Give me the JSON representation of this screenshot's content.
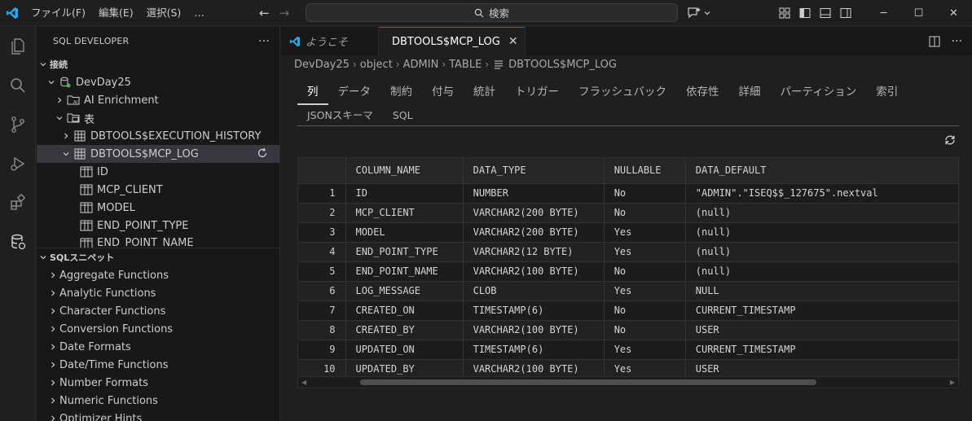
{
  "titlebar": {
    "menu": [
      "ファイル(F)",
      "編集(E)",
      "選択(S)",
      "…"
    ],
    "search_placeholder": "検索"
  },
  "sidebar": {
    "title": "SQL DEVELOPER",
    "connections_header": "接続",
    "connection_name": "DevDay25",
    "ai_enrichment": "AI Enrichment",
    "tables_label": "表",
    "tables": [
      "DBTOOLS$EXECUTION_HISTORY",
      "DBTOOLS$MCP_LOG"
    ],
    "columns": [
      "ID",
      "MCP_CLIENT",
      "MODEL",
      "END_POINT_TYPE",
      "END_POINT_NAME"
    ],
    "snippets_header": "SQLスニペット",
    "snippets": [
      "Aggregate Functions",
      "Analytic Functions",
      "Character Functions",
      "Conversion Functions",
      "Date Formats",
      "Date/Time Functions",
      "Number Formats",
      "Numeric Functions",
      "Optimizer Hints"
    ]
  },
  "editor": {
    "tabs": [
      {
        "label": "ようこそ"
      },
      {
        "label": "DBTOOLS$MCP_LOG"
      }
    ],
    "breadcrumb": [
      "DevDay25",
      "object",
      "ADMIN",
      "TABLE",
      "DBTOOLS$MCP_LOG"
    ],
    "subtabs_row1": [
      "列",
      "データ",
      "制約",
      "付与",
      "統計",
      "トリガー",
      "フラッシュバック",
      "依存性",
      "詳細",
      "パーティション",
      "索引"
    ],
    "subtabs_row2": [
      "JSONスキーマ",
      "SQL"
    ],
    "active_subtab": "列"
  },
  "grid": {
    "columns": [
      "COLUMN_NAME",
      "DATA_TYPE",
      "NULLABLE",
      "DATA_DEFAULT"
    ],
    "rows": [
      [
        "1",
        "ID",
        "NUMBER",
        "No",
        "\"ADMIN\".\"ISEQ$$_127675\".nextval"
      ],
      [
        "2",
        "MCP_CLIENT",
        "VARCHAR2(200 BYTE)",
        "No",
        "(null)"
      ],
      [
        "3",
        "MODEL",
        "VARCHAR2(200 BYTE)",
        "Yes",
        "(null)"
      ],
      [
        "4",
        "END_POINT_TYPE",
        "VARCHAR2(12 BYTE)",
        "Yes",
        "(null)"
      ],
      [
        "5",
        "END_POINT_NAME",
        "VARCHAR2(100 BYTE)",
        "No",
        "(null)"
      ],
      [
        "6",
        "LOG_MESSAGE",
        "CLOB",
        "Yes",
        "NULL"
      ],
      [
        "7",
        "CREATED_ON",
        "TIMESTAMP(6)",
        "No",
        "CURRENT_TIMESTAMP"
      ],
      [
        "8",
        "CREATED_BY",
        "VARCHAR2(100 BYTE)",
        "No",
        "USER"
      ],
      [
        "9",
        "UPDATED_ON",
        "TIMESTAMP(6)",
        "Yes",
        "CURRENT_TIMESTAMP"
      ],
      [
        "10",
        "UPDATED_BY",
        "VARCHAR2(100 BYTE)",
        "Yes",
        "USER"
      ]
    ]
  },
  "colors": {
    "accent": "#0078d4",
    "vscode_blue": "#23a9f2",
    "background": "#1f1f1f",
    "sidebar": "#181818"
  }
}
